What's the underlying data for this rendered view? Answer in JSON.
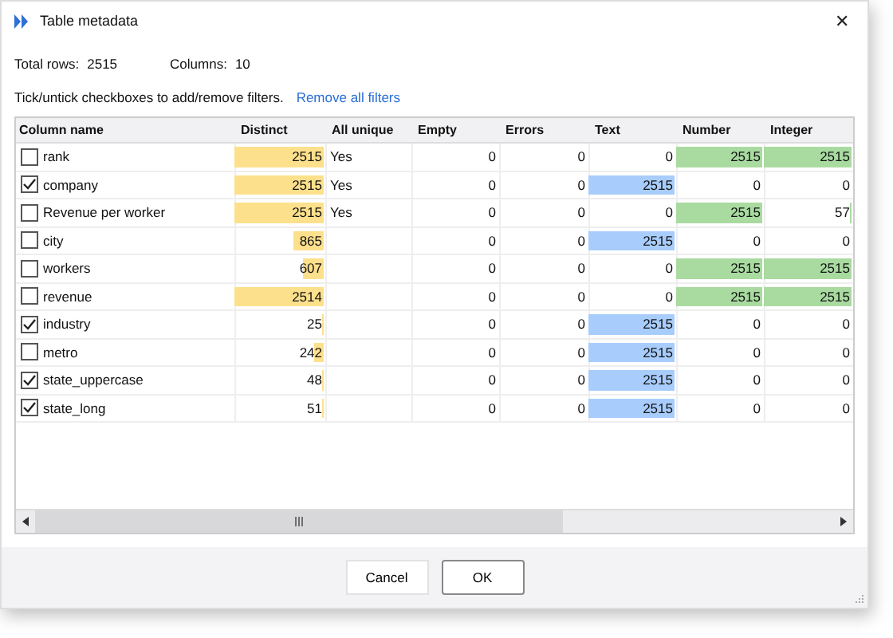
{
  "window": {
    "title": "Table metadata",
    "close": "✕"
  },
  "summary": [
    {
      "label": "Total rows:",
      "value": "2515"
    },
    {
      "label": "Columns:",
      "value": "10"
    }
  ],
  "hint": "Tick/untick checkboxes to add/remove filters.",
  "remove_link": "Remove all filters",
  "columns": [
    {
      "label": "Column name",
      "kind": "name"
    },
    {
      "label": "Distinct",
      "kind": "bar",
      "color": "#fde08c"
    },
    {
      "label": "All unique",
      "kind": "text"
    },
    {
      "label": "Empty",
      "kind": "number"
    },
    {
      "label": "Errors",
      "kind": "number"
    },
    {
      "label": "Text",
      "kind": "bar",
      "color": "#a8cdfc"
    },
    {
      "label": "Number",
      "kind": "bar",
      "color": "#a9dba0"
    },
    {
      "label": "Integer",
      "kind": "bar",
      "color": "#a9dba0"
    }
  ],
  "rows": [
    {
      "name": "rank",
      "checked": false,
      "cells": [
        {
          "value": "2515",
          "level": 1
        },
        {
          "value": "Yes"
        },
        {
          "value": "0"
        },
        {
          "value": "0"
        },
        {
          "value": "0"
        },
        {
          "value": "2515",
          "level": 1
        },
        {
          "value": "2515",
          "level": 1
        }
      ]
    },
    {
      "name": "company",
      "checked": true,
      "cells": [
        {
          "value": "2515",
          "level": 1
        },
        {
          "value": "Yes"
        },
        {
          "value": "0"
        },
        {
          "value": "0"
        },
        {
          "value": "2515",
          "level": 1
        },
        {
          "value": "0"
        },
        {
          "value": "0"
        }
      ]
    },
    {
      "name": "Revenue per worker",
      "checked": false,
      "cells": [
        {
          "value": "2515",
          "level": 1
        },
        {
          "value": "Yes"
        },
        {
          "value": "0"
        },
        {
          "value": "0"
        },
        {
          "value": "0"
        },
        {
          "value": "2515",
          "level": 1
        },
        {
          "value": "57",
          "level": 0.02
        }
      ]
    },
    {
      "name": "city",
      "checked": false,
      "cells": [
        {
          "value": "865",
          "level": 0.34
        },
        null,
        {
          "value": "0"
        },
        {
          "value": "0"
        },
        {
          "value": "2515",
          "level": 1
        },
        {
          "value": "0"
        },
        {
          "value": "0"
        }
      ]
    },
    {
      "name": "workers",
      "checked": false,
      "cells": [
        {
          "value": "607",
          "level": 0.24
        },
        null,
        {
          "value": "0"
        },
        {
          "value": "0"
        },
        {
          "value": "0"
        },
        {
          "value": "2515",
          "level": 1
        },
        {
          "value": "2515",
          "level": 1
        }
      ]
    },
    {
      "name": "revenue",
      "checked": false,
      "cells": [
        {
          "value": "2514",
          "level": 1
        },
        null,
        {
          "value": "0"
        },
        {
          "value": "0"
        },
        {
          "value": "0"
        },
        {
          "value": "2515",
          "level": 1
        },
        {
          "value": "2515",
          "level": 1
        }
      ]
    },
    {
      "name": "industry",
      "checked": true,
      "cells": [
        {
          "value": "25",
          "level": 0.01
        },
        null,
        {
          "value": "0"
        },
        {
          "value": "0"
        },
        {
          "value": "2515",
          "level": 1
        },
        {
          "value": "0"
        },
        {
          "value": "0"
        }
      ]
    },
    {
      "name": "metro",
      "checked": false,
      "cells": [
        {
          "value": "242",
          "level": 0.1
        },
        null,
        {
          "value": "0"
        },
        {
          "value": "0"
        },
        {
          "value": "2515",
          "level": 1
        },
        {
          "value": "0"
        },
        {
          "value": "0"
        }
      ]
    },
    {
      "name": "state_uppercase",
      "checked": true,
      "cells": [
        {
          "value": "48",
          "level": 0.02
        },
        null,
        {
          "value": "0"
        },
        {
          "value": "0"
        },
        {
          "value": "2515",
          "level": 1
        },
        {
          "value": "0"
        },
        {
          "value": "0"
        }
      ]
    },
    {
      "name": "state_long",
      "checked": true,
      "cells": [
        {
          "value": "51",
          "level": 0.02
        },
        null,
        {
          "value": "0"
        },
        {
          "value": "0"
        },
        {
          "value": "2515",
          "level": 1
        },
        {
          "value": "0"
        },
        {
          "value": "0"
        }
      ]
    }
  ],
  "buttons": [
    {
      "label": "Cancel",
      "default": false
    },
    {
      "label": "OK",
      "default": true
    }
  ]
}
